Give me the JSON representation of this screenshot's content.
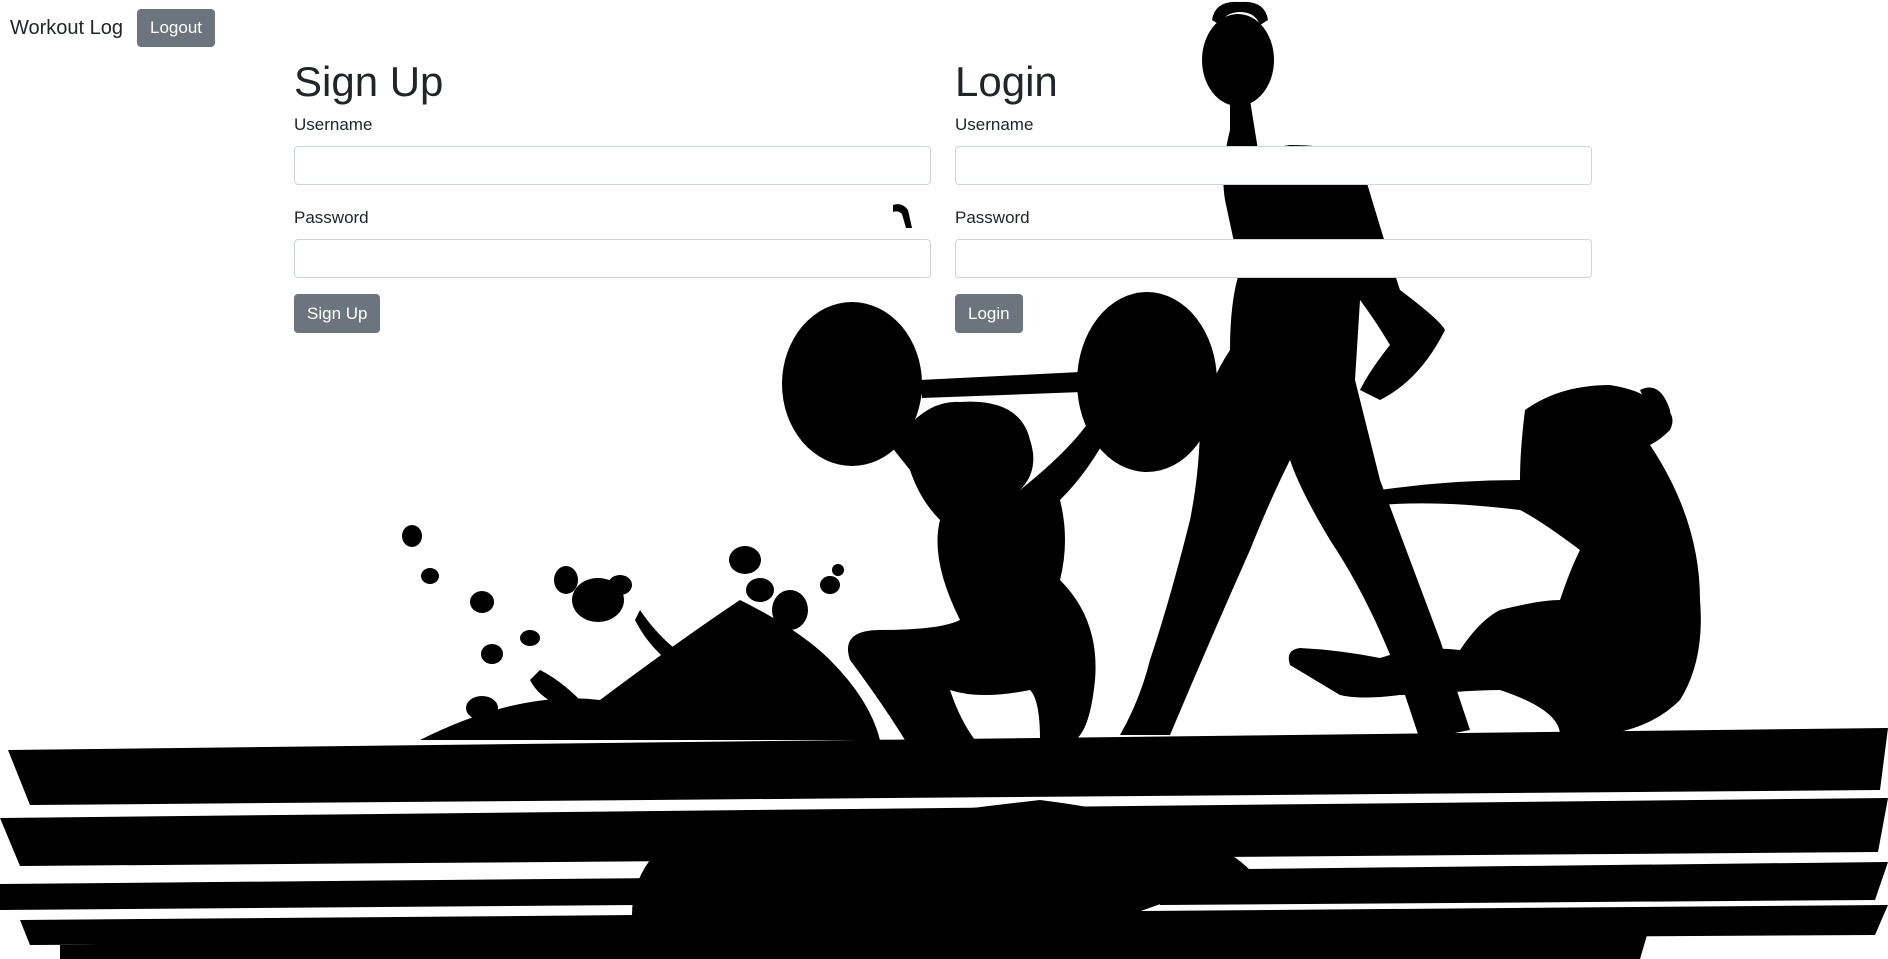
{
  "navbar": {
    "brand": "Workout Log",
    "logout_label": "Logout"
  },
  "signup": {
    "title": "Sign Up",
    "username_label": "Username",
    "username_value": "",
    "password_label": "Password",
    "password_value": "",
    "submit_label": "Sign Up"
  },
  "login": {
    "title": "Login",
    "username_label": "Username",
    "username_value": "",
    "password_label": "Password",
    "password_value": "",
    "submit_label": "Login"
  },
  "background": {
    "image": "workout-silhouettes-illustration",
    "color": "#000000"
  },
  "colors": {
    "button": "#6c757d",
    "text": "#212529",
    "input_border": "#ced4da"
  }
}
